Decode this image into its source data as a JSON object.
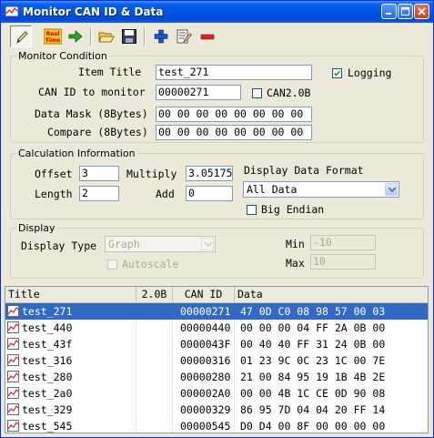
{
  "window": {
    "title": "Monitor CAN ID & Data"
  },
  "toolbar": {
    "items": [
      {
        "name": "pencil-icon"
      },
      {
        "name": "realtime-icon",
        "text": "Real Time"
      },
      {
        "name": "arrow-right-icon"
      },
      {
        "name": "open-folder-icon"
      },
      {
        "name": "save-icon"
      },
      {
        "name": "add-icon"
      },
      {
        "name": "edit-list-icon"
      },
      {
        "name": "remove-icon"
      }
    ]
  },
  "monitor": {
    "legend": "Monitor Condition",
    "item_title_label": "Item Title",
    "item_title_value": "test_271",
    "logging_label": "Logging",
    "logging_checked": true,
    "can_id_label": "CAN ID to monitor",
    "can_id_value": "00000271",
    "can20b_label": "CAN2.0B",
    "can20b_checked": false,
    "mask_label": "Data Mask (8Bytes)",
    "mask_value": "00 00 00 00 00 00 00 00",
    "compare_label": "Compare (8Bytes)",
    "compare_value": "00 00 00 00 00 00 00 00"
  },
  "calc": {
    "legend": "Calculation Information",
    "offset_label": "Offset",
    "offset_value": "3",
    "multiply_label": "Multiply",
    "multiply_value": "3.05175",
    "length_label": "Length",
    "length_value": "2",
    "add_label": "Add",
    "add_value": "0",
    "format_label": "Display Data Format",
    "format_value": "All Data",
    "big_endian_label": "Big Endian",
    "big_endian_checked": false
  },
  "display": {
    "legend": "Display",
    "type_label": "Display Type",
    "type_value": "Graph",
    "autoscale_label": "Autoscale",
    "min_label": "Min",
    "min_value": "-10",
    "max_label": "Max",
    "max_value": "10"
  },
  "list": {
    "columns": [
      "Title",
      "2.0B",
      "CAN ID",
      "Data"
    ],
    "selected_index": 0,
    "rows": [
      {
        "title": "test_271",
        "b20": "",
        "can_id": "00000271",
        "data": "47 0D C0 08 98 57 00 03"
      },
      {
        "title": "test_440",
        "b20": "",
        "can_id": "00000440",
        "data": "00 00 00 04 FF 2A 0B 00"
      },
      {
        "title": "test_43f",
        "b20": "",
        "can_id": "0000043F",
        "data": "00 40 40 FF 31 24 0B 00"
      },
      {
        "title": "test_316",
        "b20": "",
        "can_id": "00000316",
        "data": "01 23 9C 0C 23 1C 00 7E"
      },
      {
        "title": "test_280",
        "b20": "",
        "can_id": "00000280",
        "data": "21 00 84 95 19 1B 4B 2E"
      },
      {
        "title": "test_2a0",
        "b20": "",
        "can_id": "000002A0",
        "data": "00 00 4B 1C CE 0D 90 08"
      },
      {
        "title": "test_329",
        "b20": "",
        "can_id": "00000329",
        "data": "86 95 7D 04 04 20 FF 14"
      },
      {
        "title": "test_545",
        "b20": "",
        "can_id": "00000545",
        "data": "D0 D4 00 8F 00 00 00 00"
      }
    ]
  }
}
